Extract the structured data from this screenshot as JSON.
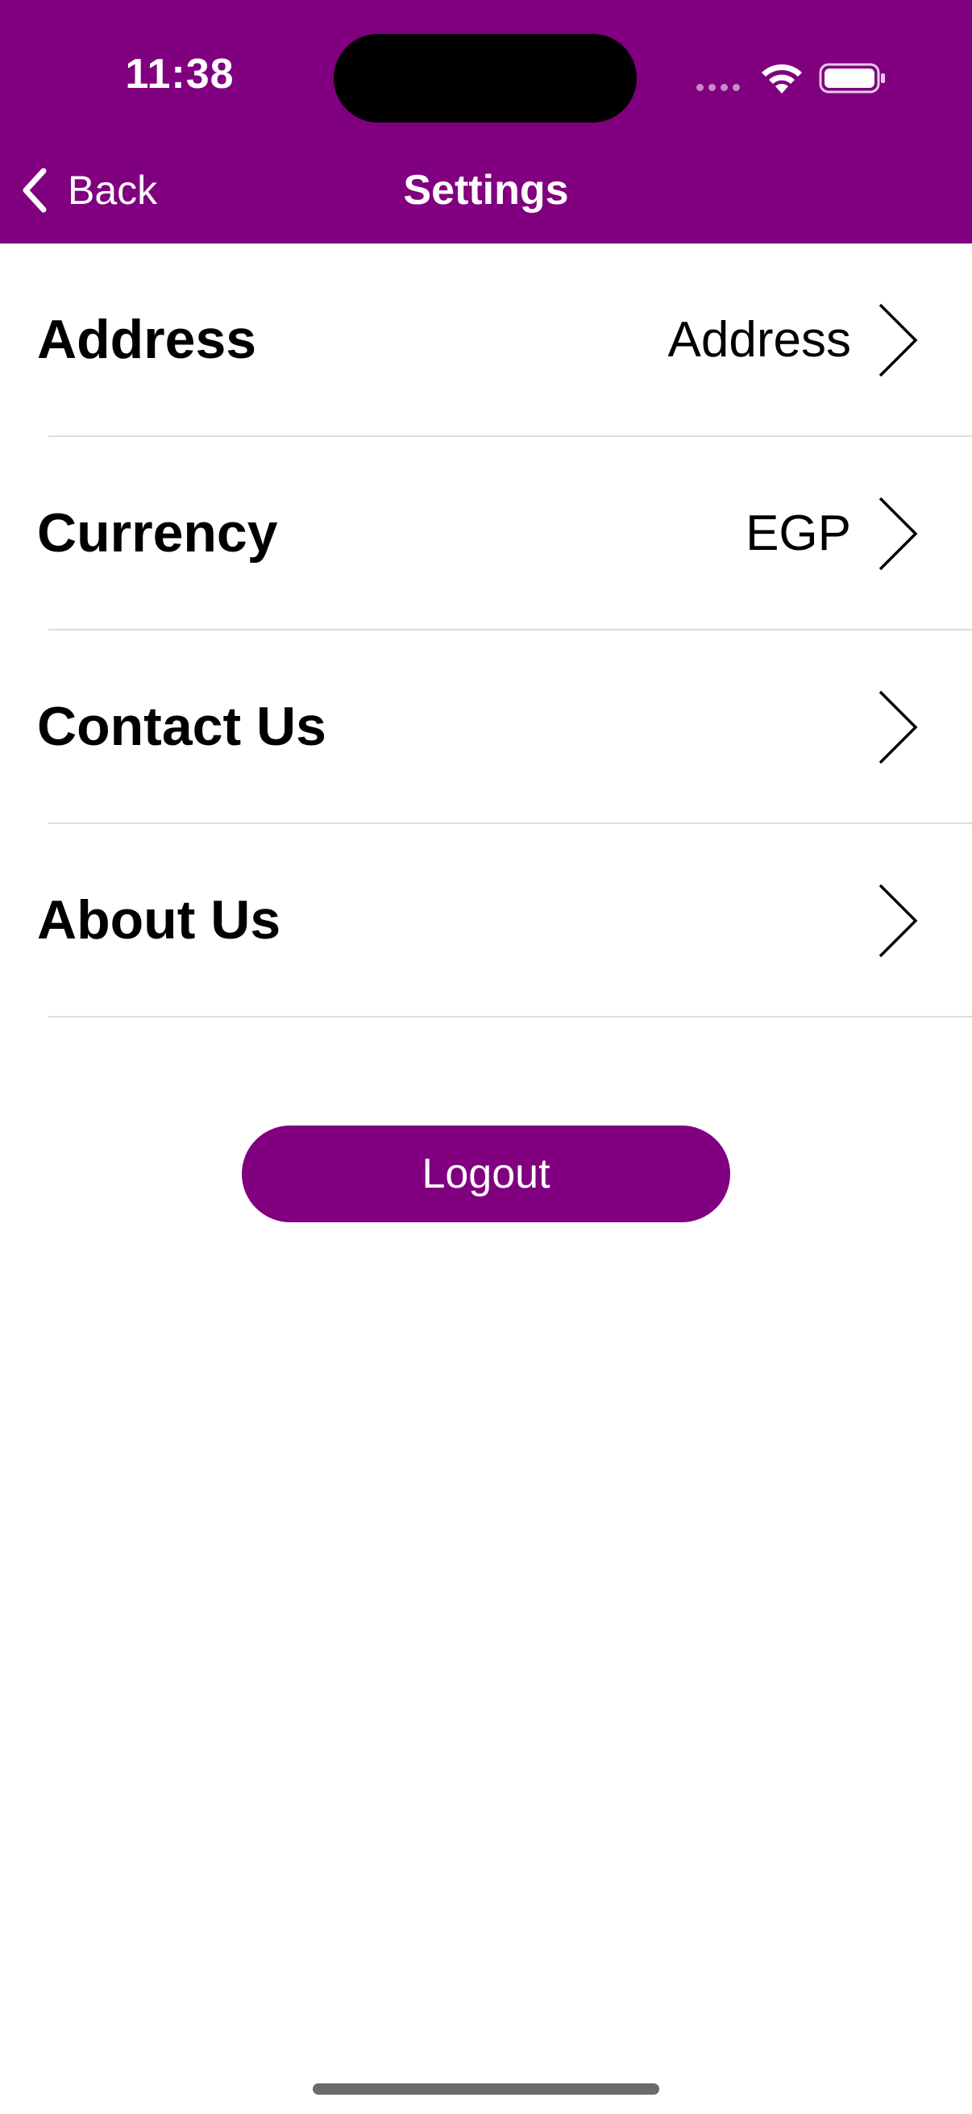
{
  "status_bar": {
    "time": "11:38",
    "icons": [
      "signal-dots-icon",
      "wifi-icon",
      "battery-icon"
    ]
  },
  "nav": {
    "back_label": "Back",
    "title": "Settings"
  },
  "settings": {
    "rows": [
      {
        "label": "Address",
        "value": "Address"
      },
      {
        "label": "Currency",
        "value": "EGP"
      },
      {
        "label": "Contact Us",
        "value": ""
      },
      {
        "label": "About Us",
        "value": ""
      }
    ]
  },
  "logout_label": "Logout",
  "colors": {
    "brand": "#800080",
    "background": "#ffffff",
    "divider": "#dcdcdc",
    "text": "#000000"
  }
}
